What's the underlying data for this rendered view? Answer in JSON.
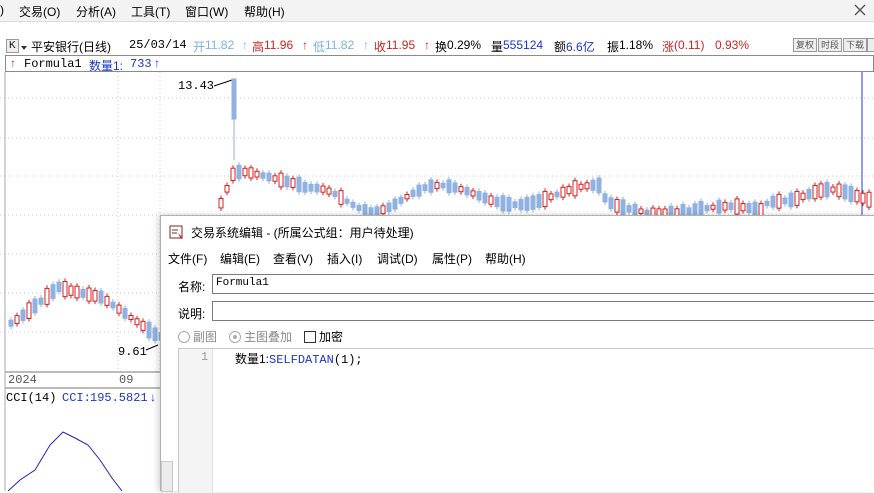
{
  "menubar": {
    "partial": ")",
    "items": [
      "交易(O)",
      "分析(A)",
      "工具(T)",
      "窗口(W)",
      "帮助(H)"
    ]
  },
  "quote": {
    "k_button": "K",
    "stock": "平安银行(日线)",
    "date": "25/03/14",
    "open_label": "开",
    "open": "11.82",
    "high_label": "高",
    "high": "11.96",
    "low_label": "低",
    "low": "11.82",
    "close_label": "收",
    "close": "11.95",
    "turnover_label": "换",
    "turnover": "0.29%",
    "volume_label": "量",
    "volume": "555124",
    "amount_label": "额",
    "amount": "6.6亿",
    "amplitude_label": "振",
    "amplitude": "1.18%",
    "change_label": "涨",
    "change": "(0.11)",
    "change_pct": "0.93%",
    "buttons": [
      "复权",
      "时段",
      "下载",
      ""
    ],
    "up_arrow": "↑"
  },
  "formula_line": {
    "name": "Formula1",
    "value_label": "数量1:",
    "value": "733"
  },
  "chart": {
    "max_label": "13.43",
    "min_label": "9.61",
    "date_labels": [
      "2024",
      "09"
    ],
    "colors": {
      "up": "#d42020",
      "down": "#8fb2e0",
      "grid": "#c9c9c9",
      "cci": "#2020c0"
    }
  },
  "cci": {
    "label": "CCI(14)",
    "value_label": "CCI:",
    "value": "195.5821",
    "arrow": "↓"
  },
  "dialog": {
    "title": "交易系统编辑 - (所属公式组：用户待处理)",
    "menu": [
      "文件(F)",
      "编辑(E)",
      "查看(V)",
      "插入(I)",
      "调试(D)",
      "属性(P)",
      "帮助(H)"
    ],
    "name_label": "名称:",
    "name_value": "Formula1",
    "desc_label": "说明:",
    "desc_value": "",
    "radio_sub": "副图",
    "radio_main": "主图叠加",
    "encrypt_label": "加密",
    "line_number": "1",
    "code_var": "数量1:",
    "code_func": "SELFDATAN",
    "code_rest": "(1);"
  }
}
